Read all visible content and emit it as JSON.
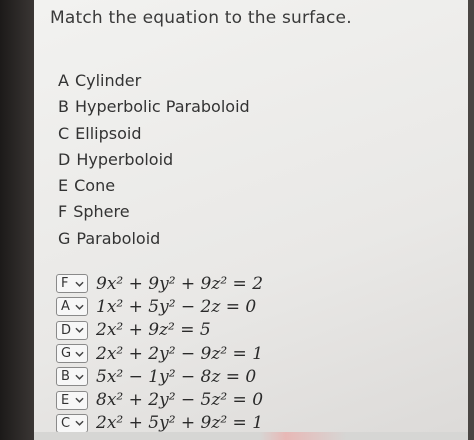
{
  "question": "Match the equation to the surface.",
  "options": [
    {
      "letter": "A",
      "name": "Cylinder"
    },
    {
      "letter": "B",
      "name": "Hyperbolic Paraboloid"
    },
    {
      "letter": "C",
      "name": "Ellipsoid"
    },
    {
      "letter": "D",
      "name": "Hyperboloid"
    },
    {
      "letter": "E",
      "name": "Cone"
    },
    {
      "letter": "F",
      "name": "Sphere"
    },
    {
      "letter": "G",
      "name": "Paraboloid"
    }
  ],
  "matches": [
    {
      "selected": "F",
      "equation": "9x² + 9y² + 9z² = 2"
    },
    {
      "selected": "A",
      "equation": "1x² + 5y² − 2z = 0"
    },
    {
      "selected": "D",
      "equation": "2x² + 9z² = 5"
    },
    {
      "selected": "G",
      "equation": "2x² + 2y² − 9z² = 1"
    },
    {
      "selected": "B",
      "equation": "5x² − 1y² − 8z = 0"
    },
    {
      "selected": "E",
      "equation": "8x² + 2y² − 5z² = 0"
    },
    {
      "selected": "C",
      "equation": "2x² + 5y² + 9z² = 1"
    }
  ],
  "icons": {
    "dropdown": "chevron-down-icon"
  }
}
